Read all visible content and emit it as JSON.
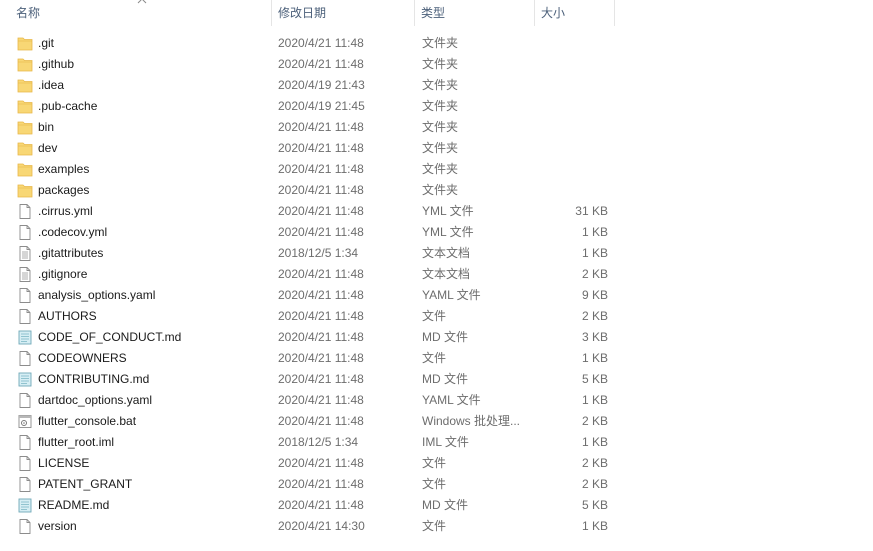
{
  "columns": {
    "name": "名称",
    "date": "修改日期",
    "type": "类型",
    "size": "大小"
  },
  "sort": {
    "column": "name",
    "direction": "ascending",
    "icon": "chevron-up-icon"
  },
  "files": [
    {
      "name": ".git",
      "date": "2020/4/21 11:48",
      "type": "文件夹",
      "size": "",
      "icon": "folder-icon"
    },
    {
      "name": ".github",
      "date": "2020/4/21 11:48",
      "type": "文件夹",
      "size": "",
      "icon": "folder-icon"
    },
    {
      "name": ".idea",
      "date": "2020/4/19 21:43",
      "type": "文件夹",
      "size": "",
      "icon": "folder-icon"
    },
    {
      "name": ".pub-cache",
      "date": "2020/4/19 21:45",
      "type": "文件夹",
      "size": "",
      "icon": "folder-icon"
    },
    {
      "name": "bin",
      "date": "2020/4/21 11:48",
      "type": "文件夹",
      "size": "",
      "icon": "folder-icon"
    },
    {
      "name": "dev",
      "date": "2020/4/21 11:48",
      "type": "文件夹",
      "size": "",
      "icon": "folder-icon"
    },
    {
      "name": "examples",
      "date": "2020/4/21 11:48",
      "type": "文件夹",
      "size": "",
      "icon": "folder-icon"
    },
    {
      "name": "packages",
      "date": "2020/4/21 11:48",
      "type": "文件夹",
      "size": "",
      "icon": "folder-icon"
    },
    {
      "name": ".cirrus.yml",
      "date": "2020/4/21 11:48",
      "type": "YML 文件",
      "size": "31 KB",
      "icon": "file-icon"
    },
    {
      "name": ".codecov.yml",
      "date": "2020/4/21 11:48",
      "type": "YML 文件",
      "size": "1 KB",
      "icon": "file-icon"
    },
    {
      "name": ".gitattributes",
      "date": "2018/12/5 1:34",
      "type": "文本文档",
      "size": "1 KB",
      "icon": "text-file-icon"
    },
    {
      "name": ".gitignore",
      "date": "2020/4/21 11:48",
      "type": "文本文档",
      "size": "2 KB",
      "icon": "text-file-icon"
    },
    {
      "name": "analysis_options.yaml",
      "date": "2020/4/21 11:48",
      "type": "YAML 文件",
      "size": "9 KB",
      "icon": "file-icon"
    },
    {
      "name": "AUTHORS",
      "date": "2020/4/21 11:48",
      "type": "文件",
      "size": "2 KB",
      "icon": "file-icon"
    },
    {
      "name": "CODE_OF_CONDUCT.md",
      "date": "2020/4/21 11:48",
      "type": "MD 文件",
      "size": "3 KB",
      "icon": "markdown-file-icon"
    },
    {
      "name": "CODEOWNERS",
      "date": "2020/4/21 11:48",
      "type": "文件",
      "size": "1 KB",
      "icon": "file-icon"
    },
    {
      "name": "CONTRIBUTING.md",
      "date": "2020/4/21 11:48",
      "type": "MD 文件",
      "size": "5 KB",
      "icon": "markdown-file-icon"
    },
    {
      "name": "dartdoc_options.yaml",
      "date": "2020/4/21 11:48",
      "type": "YAML 文件",
      "size": "1 KB",
      "icon": "file-icon"
    },
    {
      "name": "flutter_console.bat",
      "date": "2020/4/21 11:48",
      "type": "Windows 批处理...",
      "size": "2 KB",
      "icon": "batch-file-icon"
    },
    {
      "name": "flutter_root.iml",
      "date": "2018/12/5 1:34",
      "type": "IML 文件",
      "size": "1 KB",
      "icon": "file-icon"
    },
    {
      "name": "LICENSE",
      "date": "2020/4/21 11:48",
      "type": "文件",
      "size": "2 KB",
      "icon": "file-icon"
    },
    {
      "name": "PATENT_GRANT",
      "date": "2020/4/21 11:48",
      "type": "文件",
      "size": "2 KB",
      "icon": "file-icon"
    },
    {
      "name": "README.md",
      "date": "2020/4/21 11:48",
      "type": "MD 文件",
      "size": "5 KB",
      "icon": "markdown-file-icon"
    },
    {
      "name": "version",
      "date": "2020/4/21 14:30",
      "type": "文件",
      "size": "1 KB",
      "icon": "file-icon"
    }
  ],
  "colors": {
    "header_text": "#4c607a",
    "secondary_text": "#6d6d6d",
    "folder_fill": "#f8d775",
    "folder_tab": "#e8b84a"
  }
}
